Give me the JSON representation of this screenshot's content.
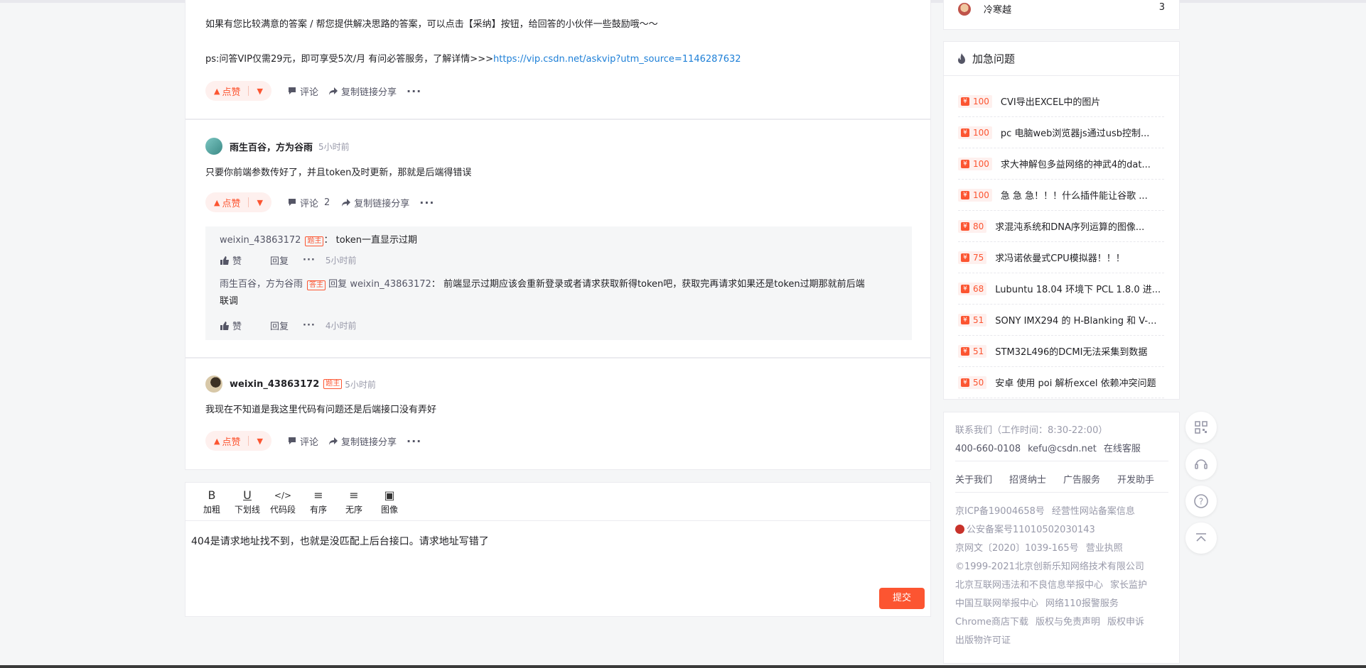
{
  "answer1": {
    "line1": "如果有您比较满意的答案 / 帮您提供解决思路的答案，可以点击【采纳】按钮，给回答的小伙伴一些鼓励哦～～",
    "line2_prefix": "ps:问答VIP仅需29元，即可享受5次/月 有问必答服务，了解详情>>>",
    "line2_link": "https://vip.csdn.net/askvip?utm_source=1146287632",
    "like": "点赞",
    "comment": "评论",
    "share": "复制链接分享"
  },
  "answer2": {
    "user": "雨生百谷，方为谷雨",
    "time": "5小时前",
    "content": "只要你前端参数传好了，并且token及时更新，那就是后端得错误",
    "like": "点赞",
    "comment": "评论",
    "comment_count": "2",
    "share": "复制链接分享",
    "replies": [
      {
        "name": "weixin_43863172",
        "tag": "题主",
        "sep": "：",
        "text": "token一直显示过期",
        "like": "赞",
        "reply": "回复",
        "time": "5小时前"
      },
      {
        "name": "雨生百谷，方为谷雨",
        "tag": "答主",
        "reply_word": "回复",
        "to": "weixin_43863172",
        "sep": "：",
        "text": "前端显示过期应该会重新登录或者请求获取新得token吧，获取完再请求如果还是token过期那就前后端",
        "text2": "联调",
        "like": "赞",
        "reply": "回复",
        "time": "4小时前"
      }
    ]
  },
  "answer3": {
    "user": "weixin_43863172",
    "tag": "题主",
    "time": "5小时前",
    "content": "我现在不知道是我这里代码有问题还是后端接口没有弄好",
    "like": "点赞",
    "comment": "评论",
    "share": "复制链接分享"
  },
  "editor": {
    "tools": [
      {
        "icon": "B",
        "label": "加粗"
      },
      {
        "icon": "U",
        "label": "下划线"
      },
      {
        "icon": "</>",
        "label": "代码段"
      },
      {
        "icon": "≡",
        "label": "有序"
      },
      {
        "icon": "≡",
        "label": "无序"
      },
      {
        "icon": "▣",
        "label": "图像"
      }
    ],
    "content": "404是请求地址找不到，也就是没匹配上后台接口。请求地址写错了",
    "submit": "提交"
  },
  "sidebar": {
    "top_user": {
      "name": "冷寒越",
      "count": "3"
    },
    "urgent_title": "加急问题",
    "questions": [
      {
        "bounty": "100",
        "title": "CVI导出EXCEL中的图片"
      },
      {
        "bounty": "100",
        "title": "pc 电脑web浏览器js通过usb控制..."
      },
      {
        "bounty": "100",
        "title": "求大神解包多益网络的神武4的dat..."
      },
      {
        "bounty": "100",
        "title": "急 急 急！！！什么插件能让谷歌 ..."
      },
      {
        "bounty": "80",
        "title": "求混沌系统和DNA序列运算的图像..."
      },
      {
        "bounty": "75",
        "title": "求冯诺依曼式CPU模拟器！！！"
      },
      {
        "bounty": "68",
        "title": "Lubuntu 18.04 环境下 PCL 1.8.0 进..."
      },
      {
        "bounty": "51",
        "title": "SONY IMX294 的 H-Blanking 和 V-..."
      },
      {
        "bounty": "51",
        "title": "STM32L496的DCMI无法采集到数据"
      },
      {
        "bounty": "50",
        "title": "安卓 使用 poi 解析excel 依赖冲突问题"
      }
    ],
    "footer": {
      "contact": "联系我们（工作时间：8:30-22:00）",
      "phone": "400-660-0108",
      "email": "kefu@csdn.net",
      "online": "在线客服",
      "links": [
        "关于我们",
        "招贤纳士",
        "广告服务",
        "开发助手"
      ],
      "icp": "京ICP备19004658号",
      "icp2": "经营性网站备案信息",
      "police": "公安备案号11010502030143",
      "culture": "京网文〔2020〕1039-165号",
      "license": "营业执照",
      "copyright": "©1999-2021北京创新乐知网络技术有限公司",
      "report1": "北京互联网违法和不良信息举报中心",
      "report1b": "家长监护",
      "report2": "中国互联网举报中心",
      "report2b": "网络110报警服务",
      "misc1": "Chrome商店下载",
      "misc1b": "版权与免责声明",
      "misc1c": "版权申诉",
      "misc2": "出版物许可证"
    }
  },
  "colors": {
    "accent": "#fc5531",
    "link": "#1d7fd7"
  }
}
